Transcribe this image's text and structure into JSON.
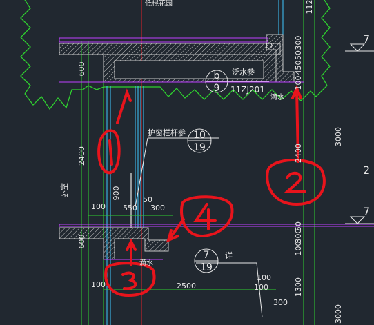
{
  "diagram": {
    "background_color": "#212830",
    "labels": {
      "top_cut": "低棍花园",
      "flashing_ref": "泛水参",
      "detail_b": "b",
      "detail_b_sheet": "9",
      "std_ref": "11ZJ201",
      "drip_upper": "滴水",
      "drip_lower": "滴水",
      "railing_ref": "护窗栏杆参",
      "detail_10": "10",
      "detail_10_sheet": "19",
      "bedroom": "卧室",
      "detail_7": "7",
      "detail_7_sheet": "19",
      "see_detail": "详",
      "dim_600_upper": "600",
      "dim_2400": "2400",
      "dim_900": "900",
      "dim_100_a": "100",
      "dim_550": "550",
      "dim_50_a": "50",
      "dim_300_a": "300",
      "dim_600_lower": "600",
      "dim_100_b": "100",
      "dim_2500": "2500",
      "dim_100_c": "100",
      "dim_100_d": "100",
      "dim_300_b": "300",
      "r_112": "112",
      "r_300_a": "300",
      "r_50_a": "50",
      "r_450": "450",
      "r_100_a": "100",
      "r_2400": "2400",
      "r_50_b": "50",
      "r_300_b": "300",
      "r_100_b": "100",
      "r_1300": "1300",
      "r_3000_a": "3000",
      "r_3000_b": "3000",
      "r_7_a": "7",
      "r_2": "2",
      "r_7_b": "7"
    },
    "annotations": [
      "1",
      "2",
      "3",
      "4"
    ]
  }
}
